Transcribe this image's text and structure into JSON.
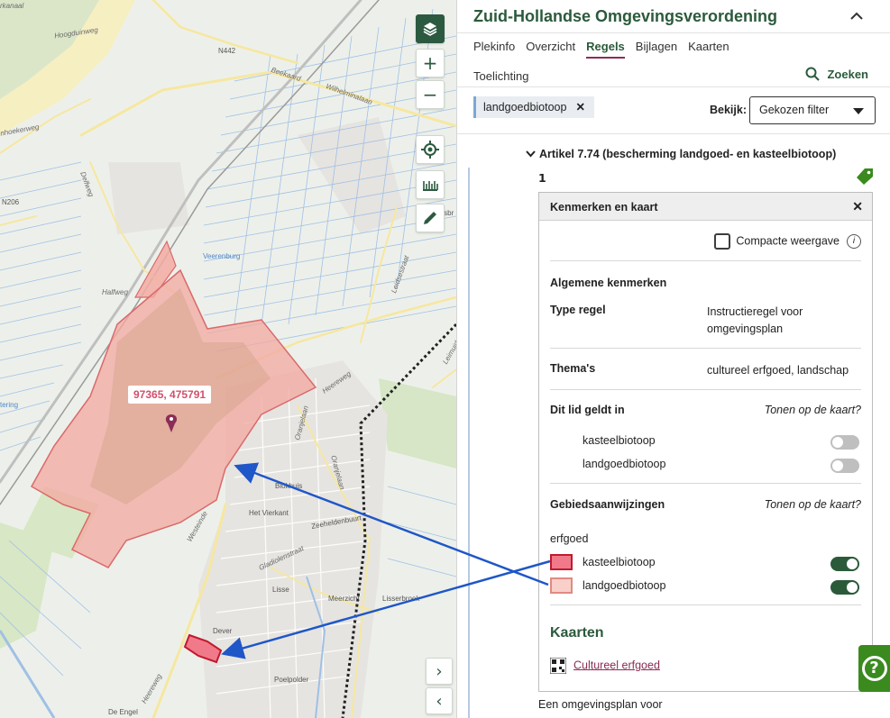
{
  "map": {
    "coordinate_label": "97365, 475791",
    "place_labels": [
      "Hoogduinweg",
      "N442",
      "Beekaard",
      "Wilhelminalaan",
      "nhoekerweg",
      "N206",
      "Delfweg",
      "Veerenburg",
      "Halfweg",
      "Heereweg",
      "Leidsestraat",
      "Leimuide",
      "Blokhuis",
      "Het Vierkant",
      "Zeeheldenbuurt",
      "Lisse",
      "Meerzicht",
      "Lisserbroek",
      "Dever",
      "Poelpolder",
      "De Engel",
      "Oranjelaan",
      "Gladiolenstraat",
      "Westeinde",
      "Elsbr",
      "rkanaal",
      "tering"
    ],
    "buttons": {
      "layers_icon": "layers-icon",
      "zoom_in": "+",
      "zoom_out": "−",
      "locate_icon": "crosshair-icon",
      "measure_icon": "ruler-icon",
      "draw_icon": "pencil-icon",
      "expand": "›",
      "collapse": "‹"
    },
    "colors": {
      "landgoedbiotoop_fill": "#f2aba3",
      "kasteelbiotoop_fill": "#f07a8a",
      "arrow": "#1f56c8"
    }
  },
  "panel": {
    "title": "Zuid-Hollandse Omgevingsverordening",
    "tabs": [
      "Plekinfo",
      "Overzicht",
      "Regels",
      "Bijlagen",
      "Kaarten"
    ],
    "active_tab": "Regels",
    "tab_second_row": "Toelichting",
    "search_label": "Zoeken",
    "filter_chip": "landgoedbiotoop",
    "bekijk_label": "Bekijk:",
    "bekijk_value": "Gekozen filter",
    "artikel_title": "Artikel 7.74 (bescherming landgoed- en kasteelbiotoop)",
    "lid_number": "1",
    "card": {
      "title": "Kenmerken en kaart",
      "compact_label": "Compacte weergave",
      "algemene_heading": "Algemene kenmerken",
      "type_regel_label": "Type regel",
      "type_regel_value": "Instructieregel voor omgevingsplan",
      "themas_label": "Thema's",
      "themas_value": "cultureel erfgoed, landschap",
      "geldt_in_label": "Dit lid geldt in",
      "tonen_label": "Tonen op de kaart?",
      "geldt_items": [
        {
          "label": "kasteelbiotoop",
          "on": false
        },
        {
          "label": "landgoedbiotoop",
          "on": false
        }
      ],
      "gebied_label": "Gebiedsaanwijzingen",
      "gebied_tonen": "Tonen op de kaart?",
      "gebied_group": "erfgoed",
      "gebied_items": [
        {
          "label": "kasteelbiotoop",
          "on": true,
          "color": "#f07a8a",
          "border": "#c2192e"
        },
        {
          "label": "landgoedbiotoop",
          "on": true,
          "color": "#f9cfc9",
          "border": "#e08a82"
        }
      ],
      "kaarten_heading": "Kaarten",
      "kaart_link": "Cultureel erfgoed"
    },
    "bottom_text": "Een omgevingsplan voor"
  }
}
